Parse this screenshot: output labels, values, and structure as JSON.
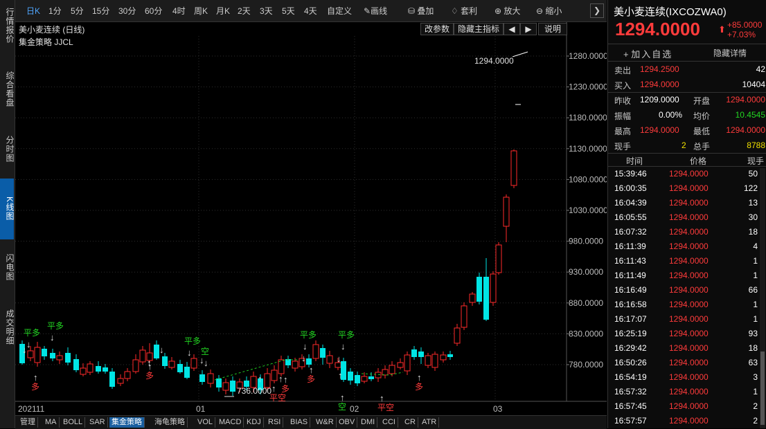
{
  "left_tabs": [
    "行情报价",
    "综合看盘",
    "分时图",
    "K线图",
    "闪电图",
    "成交明细"
  ],
  "toolbar": {
    "periods": [
      "日K",
      "1分",
      "5分",
      "15分",
      "30分",
      "60分",
      "4时",
      "周K",
      "月K",
      "2天",
      "3天",
      "5天",
      "4天",
      "自定义"
    ],
    "tools": [
      "画线",
      "叠加",
      "套利",
      "放大",
      "缩小"
    ]
  },
  "chart": {
    "instrument_label": "美小麦连续 (日线)",
    "strategy_label": "集金策略 JJCL",
    "buttons": [
      "改参数",
      "隐藏主指标",
      "◀",
      "▶",
      "说明"
    ],
    "last_price_label": "1294.0000",
    "low_label": "736.0000",
    "x_labels": [
      "202111",
      "01",
      "02",
      "03"
    ],
    "y_ticks": [
      "1280.0000",
      "1230.0000",
      "1180.0000",
      "1130.0000",
      "1080.0000",
      "1030.0000",
      "980.0000",
      "930.0000",
      "880.0000",
      "830.0000",
      "780.0000"
    ],
    "signals_above": [
      "平多",
      "平多",
      "平多",
      "空",
      "平多",
      "平多"
    ],
    "signals_below": [
      "多",
      "多",
      "多",
      "平空",
      "多",
      "空",
      "平空",
      "多"
    ],
    "up_color": "#ff2a2a",
    "down_color": "#00e5e5"
  },
  "bottom_tabs": [
    "管理",
    "MA",
    "BOLL",
    "SAR",
    "集金策略",
    "海龟策略",
    "VOL",
    "MACD",
    "KDJ",
    "RSI",
    "BIAS",
    "W&R",
    "OBV",
    "DMI",
    "CCI",
    "CR",
    "ATR"
  ],
  "quote": {
    "name": "美小麦连续(IXCOZWA0)",
    "price": "1294.0000",
    "change": "+85.0000",
    "change_pct": "+7.03%",
    "add_watch": "加入自选",
    "hide_detail": "隐藏详情",
    "sell_label": "卖出",
    "sell_price": "1294.2500",
    "sell_vol": "42",
    "buy_label": "买入",
    "buy_price": "1294.0000",
    "buy_vol": "10404",
    "prev_close_label": "昨收",
    "prev_close": "1209.0000",
    "open_label": "开盘",
    "open": "1294.0000",
    "amplitude_label": "振幅",
    "amplitude": "0.00%",
    "avg_label": "均价",
    "avg": "10.4545",
    "high_label": "最高",
    "high": "1294.0000",
    "low_label": "最低",
    "low": "1294.0000",
    "cur_vol_label": "现手",
    "cur_vol": "2",
    "total_vol_label": "总手",
    "total_vol": "8788"
  },
  "ticks": {
    "headers": [
      "时间",
      "价格",
      "现手"
    ],
    "rows": [
      [
        "15:39:46",
        "1294.0000",
        "50"
      ],
      [
        "16:00:35",
        "1294.0000",
        "122"
      ],
      [
        "16:04:39",
        "1294.0000",
        "13"
      ],
      [
        "16:05:55",
        "1294.0000",
        "30"
      ],
      [
        "16:07:32",
        "1294.0000",
        "18"
      ],
      [
        "16:11:39",
        "1294.0000",
        "4"
      ],
      [
        "16:11:43",
        "1294.0000",
        "1"
      ],
      [
        "16:11:49",
        "1294.0000",
        "1"
      ],
      [
        "16:16:49",
        "1294.0000",
        "66"
      ],
      [
        "16:16:58",
        "1294.0000",
        "1"
      ],
      [
        "16:17:07",
        "1294.0000",
        "1"
      ],
      [
        "16:25:19",
        "1294.0000",
        "93"
      ],
      [
        "16:29:42",
        "1294.0000",
        "18"
      ],
      [
        "16:50:26",
        "1294.0000",
        "63"
      ],
      [
        "16:54:19",
        "1294.0000",
        "3"
      ],
      [
        "16:57:32",
        "1294.0000",
        "1"
      ],
      [
        "16:57:45",
        "1294.0000",
        "2"
      ],
      [
        "16:57:57",
        "1294.0000",
        "2"
      ]
    ]
  }
}
